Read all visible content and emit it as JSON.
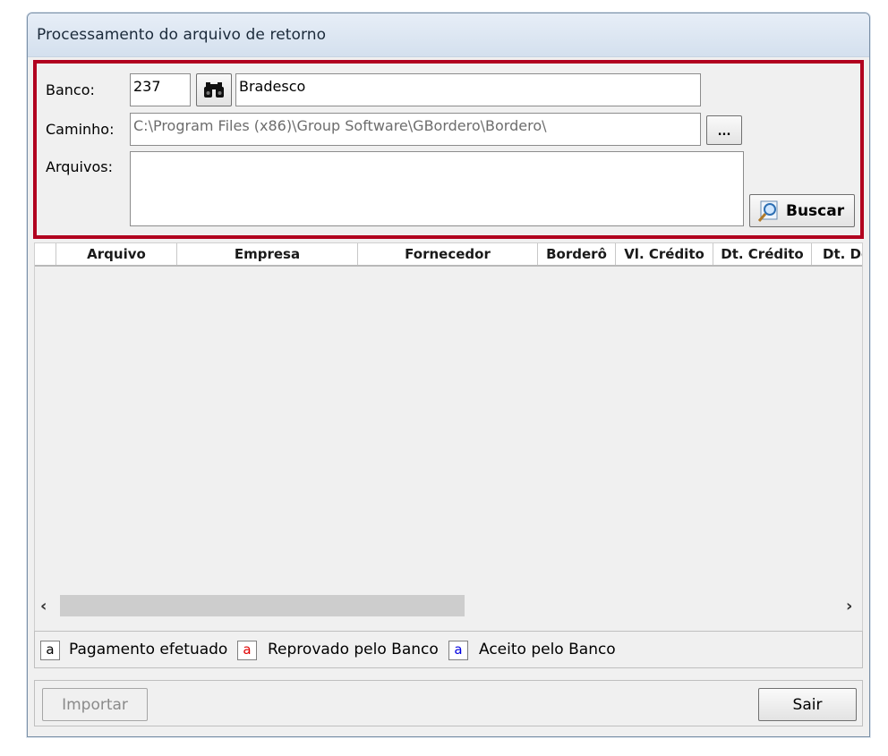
{
  "window": {
    "title": "Processamento do arquivo de retorno"
  },
  "filter": {
    "banco_label": "Banco:",
    "banco_code": "237",
    "banco_name": "Bradesco",
    "caminho_label": "Caminho:",
    "caminho_value": "C:\\Program Files (x86)\\Group Software\\GBordero\\Bordero\\",
    "browse_label": "...",
    "arquivos_label": "Arquivos:",
    "arquivos_value": "",
    "buscar_label": "Buscar",
    "highlight_color": "#b1001f"
  },
  "grid": {
    "columns": [
      "Arquivo",
      "Empresa",
      "Fornecedor",
      "Borderô",
      "Vl. Crédito",
      "Dt. Crédito",
      "Dt. De"
    ],
    "rows": [],
    "scroll_left_icon": "chevron-left-icon",
    "scroll_right_icon": "chevron-right-icon"
  },
  "legend": {
    "items": [
      {
        "swatch": "a",
        "label": "Pagamento efetuado",
        "color": "#000000"
      },
      {
        "swatch": "a",
        "label": "Reprovado pelo Banco",
        "color": "#e00000"
      },
      {
        "swatch": "a",
        "label": "Aceito pelo Banco",
        "color": "#0000e0"
      }
    ]
  },
  "footer": {
    "importar_label": "Importar",
    "sair_label": "Sair"
  }
}
